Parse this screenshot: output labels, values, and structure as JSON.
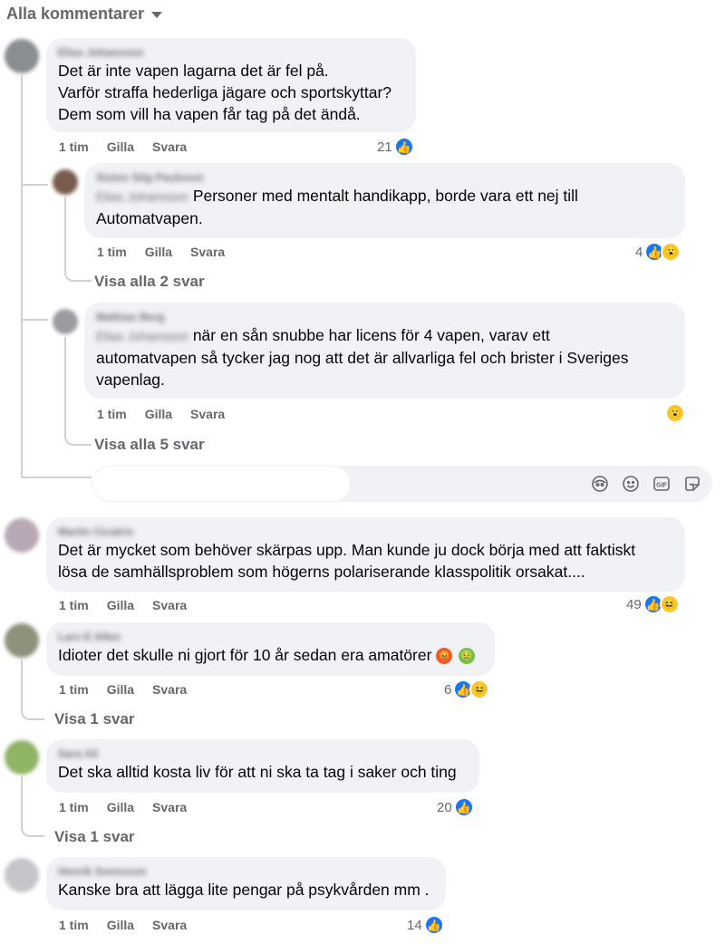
{
  "header": {
    "filter_label": "Alla kommentarer"
  },
  "actions": {
    "time": "1 tim",
    "like": "Gilla",
    "reply": "Svara"
  },
  "comments": [
    {
      "author": "Elias Johansson",
      "lines": [
        "Det är inte vapen lagarna det är fel på.",
        "Varför straffa hederliga jägare och sportskyttar?",
        "Dem som vill ha vapen får tag på det ändå."
      ],
      "reaction_count": "21",
      "reactions": [
        "like"
      ],
      "replies": [
        {
          "author": "Sixten Stig Paulsson",
          "mention": "Elias Johansson",
          "line1": "Personer med mentalt handikapp, borde vara ett nej till",
          "line2": "Automatvapen.",
          "reaction_count": "4",
          "reactions": [
            "like",
            "wow"
          ],
          "view_replies": "Visa alla 2 svar"
        },
        {
          "author": "Mathias Berg",
          "mention": "Elias Johansson",
          "line1": "när en sån snubbe har licens för 4 vapen, varav ett",
          "line2": "automatvapen så tycker jag nog att det är allvarliga fel och brister i Sveriges",
          "line3": "vapenlag.",
          "reaction_count": "",
          "reactions": [
            "wow"
          ],
          "view_replies": "Visa alla 5 svar"
        }
      ]
    },
    {
      "author": "Martin Cicatrix",
      "lines": [
        "Det är mycket som behöver skärpas upp. Man kunde ju dock börja med att faktiskt",
        "lösa de samhällsproblem som högerns polariserande klasspolitik orsakat...."
      ],
      "reaction_count": "49",
      "reactions": [
        "like",
        "haha"
      ]
    },
    {
      "author": "Lars E Allen",
      "lines": [
        "Idioter det skulle ni gjort för 10 år sedan era amatörer"
      ],
      "reaction_count": "6",
      "reactions": [
        "like",
        "haha"
      ],
      "view_replies": "Visa 1 svar"
    },
    {
      "author": "Sara Ali",
      "lines": [
        "Det ska alltid kosta liv för att ni ska ta tag i saker och ting"
      ],
      "reaction_count": "20",
      "reactions": [
        "like"
      ],
      "view_replies": "Visa 1 svar"
    },
    {
      "author": "Henrik Svensson",
      "lines": [
        "Kanske bra att lägga lite pengar på psykvården mm ."
      ],
      "reaction_count": "14",
      "reactions": [
        "like"
      ]
    }
  ],
  "composer": {
    "tools": [
      "avatar-sticker-icon",
      "emoji-icon",
      "gif-icon",
      "sticker-icon"
    ],
    "gif_label": "GIF"
  },
  "colors": {
    "bubble": "#f0f2f5",
    "meta": "#65676b",
    "like": "#1877f2",
    "text": "#050505"
  }
}
